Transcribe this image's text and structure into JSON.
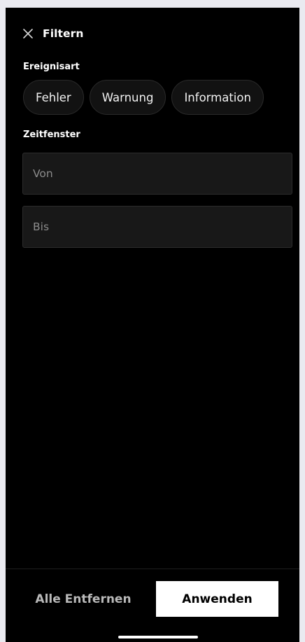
{
  "header": {
    "close_icon": "close-icon",
    "title": "Filtern"
  },
  "event_type": {
    "label": "Ereignisart",
    "options": [
      "Fehler",
      "Warnung",
      "Information"
    ]
  },
  "time_window": {
    "label": "Zeitfenster",
    "from": {
      "value": "",
      "placeholder": "Von"
    },
    "to": {
      "value": "",
      "placeholder": "Bis"
    }
  },
  "actions": {
    "clear_label": "Alle Entfernen",
    "apply_label": "Anwenden"
  },
  "colors": {
    "background": "#000000",
    "chip_background": "#121212",
    "field_background": "#181818",
    "apply_background": "#ffffff",
    "apply_text": "#000000",
    "clear_text": "#b9b9b9"
  }
}
